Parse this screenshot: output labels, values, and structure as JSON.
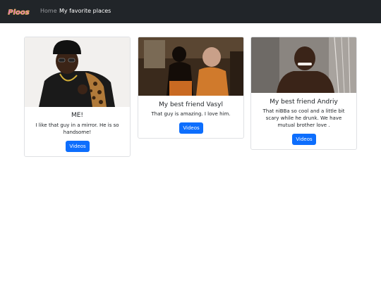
{
  "navbar": {
    "brand": "Ploos",
    "links": [
      {
        "label": "Home"
      },
      {
        "label": "My favorite places"
      }
    ]
  },
  "cards": [
    {
      "title": "ME!",
      "text": "I like that guy in a mirror. He is so handsome!",
      "button": "Videos"
    },
    {
      "title": "My best friend Vasyl",
      "text": "That guy is amazing. I love him.",
      "button": "Videos"
    },
    {
      "title": "My best friend Andriy",
      "text": "That niBBa so cool and a little bit scary while he drunk. We have mutual brother love .",
      "button": "Videos"
    }
  ],
  "colors": {
    "navbar": "#212529",
    "button": "#0d6efd",
    "card_border": "#dfe1e4"
  }
}
